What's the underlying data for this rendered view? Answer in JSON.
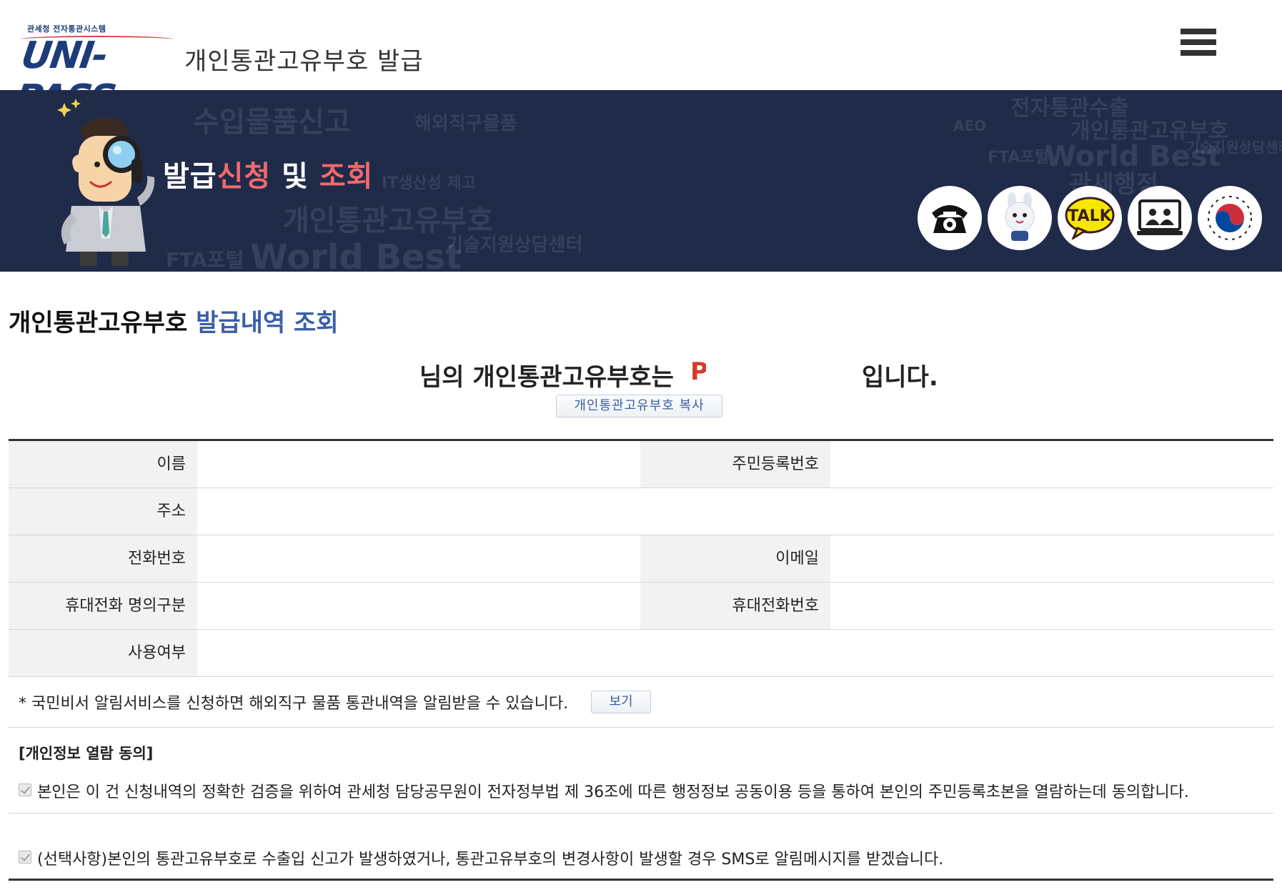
{
  "header": {
    "logo_small": "관세청 전자통관시스템",
    "logo_big": "UNI-PASS",
    "title": "개인통관고유부호 발급",
    "menu_icon": "hamburger-menu-icon"
  },
  "banner": {
    "title_part1": "발급",
    "title_part2": "신청",
    "title_part3": " 및 ",
    "title_part4": "조회",
    "bg_words": [
      "수입물품신고",
      "해외직구물품",
      "개인통관고유부호",
      "World Best",
      "FTA포털",
      "기술지원상담센터",
      "전자통관수출",
      "AEO",
      "관세행정",
      "IT생산성 제고"
    ],
    "quick_links": [
      {
        "icon": "telephone-icon",
        "label": "전화상담"
      },
      {
        "icon": "mascot-rabbit-icon",
        "label": "챗봇"
      },
      {
        "icon": "kakaotalk-icon",
        "label": "TALK"
      },
      {
        "icon": "video-consult-icon",
        "label": "화상상담"
      },
      {
        "icon": "government-emblem-icon",
        "label": "정부"
      }
    ]
  },
  "main": {
    "section_title_black": "개인통관고유부호 ",
    "section_title_blue": "발급내역 조회",
    "message_prefix": "님의 개인통관고유부호는",
    "message_code": "P",
    "message_suffix": "입니다.",
    "copy_button": "개인통관고유부호 복사"
  },
  "table": {
    "rows": [
      {
        "label1": "이름",
        "value1": "",
        "label2": "주민등록번호",
        "value2": ""
      },
      {
        "label1": "주소",
        "value1": ""
      },
      {
        "label1": "전화번호",
        "value1": "",
        "label2": "이메일",
        "value2": ""
      },
      {
        "label1": "휴대전화 명의구분",
        "value1": "",
        "label2": "휴대전화번호",
        "value2": ""
      },
      {
        "label1": "사용여부",
        "value1": ""
      }
    ]
  },
  "notice": {
    "text": "* 국민비서 알림서비스를 신청하면 해외직구 물품 통관내역을 알림받을 수 있습니다.",
    "button": "보기"
  },
  "consent": {
    "title": "[개인정보 열람 동의]",
    "item1": "본인은 이 건 신청내역의 정확한 검증을 위하여 관세청 담당공무원이 전자정부법 제 36조에 따른 행정정보 공동이용 등을 통하여 본인의 주민등록초본을 열람하는데 동의합니다.",
    "item1_checked": true,
    "item2": "(선택사항)본인의 통관고유부호로 수출입 신고가 발생하였거나, 통관고유부호의 변경사항이 발생할 경우 SMS로 알림메시지를 받겠습니다.",
    "item2_checked": true
  },
  "colors": {
    "banner_bg": "#202b4a",
    "accent_blue": "#3a5fa6",
    "accent_red": "#d43b2c",
    "banner_highlight": "#f06a6a"
  }
}
